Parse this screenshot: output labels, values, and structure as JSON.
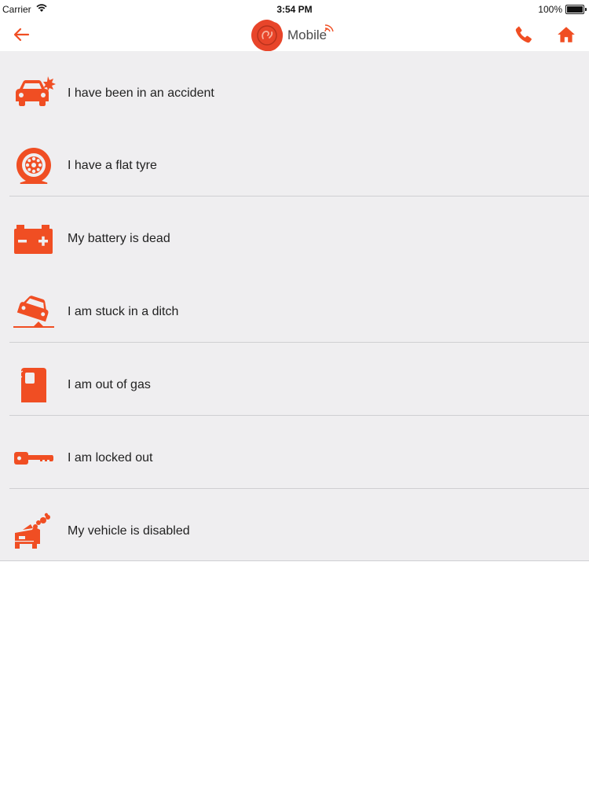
{
  "status_bar": {
    "carrier": "Carrier",
    "time": "3:54 PM",
    "battery": "100%"
  },
  "nav": {
    "logo_text": "Mobile",
    "accent_color": "#f04e23"
  },
  "items": [
    {
      "label": "I have been in an accident",
      "icon": "car-accident-icon"
    },
    {
      "label": "I have a flat tyre",
      "icon": "flat-tyre-icon"
    },
    {
      "label": "My battery is dead",
      "icon": "battery-icon"
    },
    {
      "label": "I am stuck in a ditch",
      "icon": "car-ditch-icon"
    },
    {
      "label": "I am out of gas",
      "icon": "gas-pump-icon"
    },
    {
      "label": "I am locked out",
      "icon": "key-icon"
    },
    {
      "label": "My vehicle is disabled",
      "icon": "smoking-car-icon"
    }
  ]
}
